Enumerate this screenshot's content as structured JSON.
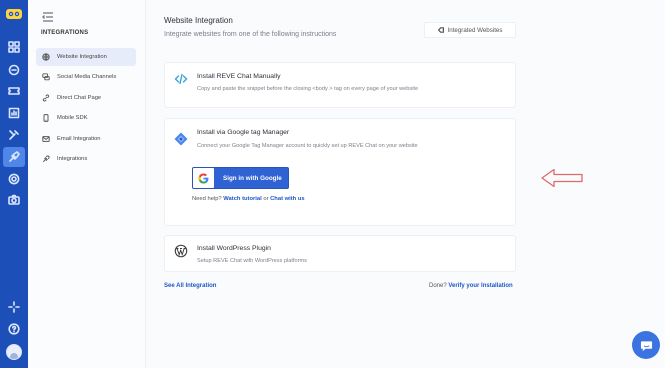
{
  "sidebar": {
    "heading": "INTEGRATIONS",
    "items": [
      {
        "label": "Website Integration",
        "icon": "globe-icon",
        "active": true
      },
      {
        "label": "Social Media Channels",
        "icon": "chat-bubbles-icon",
        "active": false
      },
      {
        "label": "Direct Chat Page",
        "icon": "link-icon",
        "active": false
      },
      {
        "label": "Mobile SDK",
        "icon": "mobile-icon",
        "active": false
      },
      {
        "label": "Email Integration",
        "icon": "mail-icon",
        "active": false
      },
      {
        "label": "Integrations",
        "icon": "plug-icon",
        "active": false
      }
    ]
  },
  "main": {
    "title": "Website Integration",
    "subtitle": "Integrate websites from one of the following instructions",
    "integrated_websites_button": "Integrated Websites",
    "cards": {
      "manual": {
        "title": "Install REVE Chat Manually",
        "description": "Copy and paste the snippet before the closing <body > tag on every page of your website",
        "icon": "code-icon"
      },
      "gtm": {
        "title": "Install via Google tag Manager",
        "description": "Connect your Google Tag Manager account to quickly set up REVE Chat on your website",
        "icon": "google-tag-manager-icon",
        "signin_button": "Sign in with Google",
        "help_prefix": "Need help?",
        "help_link1": "Watch tutorial",
        "help_or": "or",
        "help_link2": "Chat with us"
      },
      "wordpress": {
        "title": "Install WordPress Plugin",
        "description": "Setup REVE Chat with WordPress platforms",
        "icon": "wordpress-icon"
      }
    },
    "see_all": "See All Integration",
    "done_prefix": "Done?",
    "verify_link": "Verify your Installation"
  },
  "colors": {
    "rail": "#1d4fb8",
    "accent": "#1f56c8",
    "google_button": "#2f62d2",
    "arrow": "#e06a6a"
  }
}
